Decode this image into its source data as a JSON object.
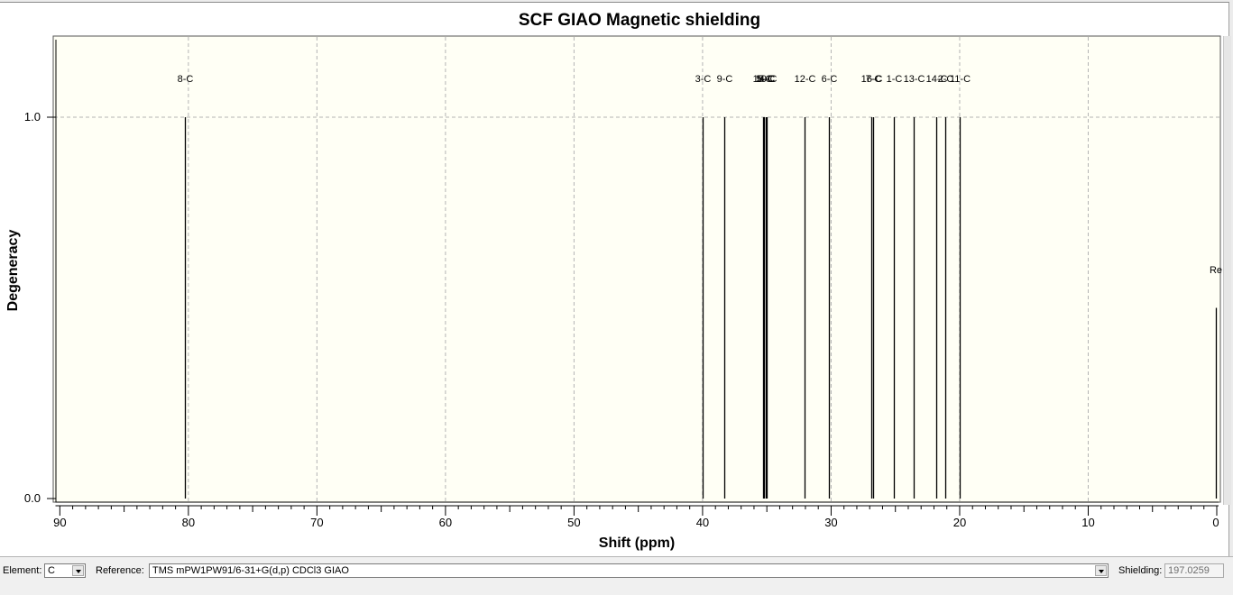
{
  "chart_data": {
    "type": "bar",
    "title": "SCF GIAO Magnetic shielding",
    "xlabel": "Shift (ppm)",
    "ylabel": "Degeneracy",
    "xlim": [
      90.2,
      0
    ],
    "ylim": [
      0,
      1.21
    ],
    "x_ticks": [
      90,
      80,
      70,
      60,
      50,
      40,
      30,
      20,
      10,
      0
    ],
    "x_tick_labels": [
      "90",
      "80",
      "70",
      "60",
      "50",
      "40",
      "30",
      "20",
      "10",
      "0"
    ],
    "y_ticks": [
      0,
      1
    ],
    "y_tick_labels": [
      "0.0",
      "1.0"
    ],
    "grid": true,
    "peaks": [
      {
        "label": "8-C",
        "x": 80.3,
        "y": 1.0
      },
      {
        "label": "3-C",
        "x": 40.0,
        "y": 1.0
      },
      {
        "label": "9-C",
        "x": 38.3,
        "y": 1.0
      },
      {
        "label": "15-C",
        "x": 35.3,
        "y": 1.0
      },
      {
        "label": "5-C",
        "x": 35.2,
        "y": 1.0
      },
      {
        "label": "10-C",
        "x": 35.1,
        "y": 1.0
      },
      {
        "label": "4-C",
        "x": 35.0,
        "y": 1.0
      },
      {
        "label": "12-C",
        "x": 32.1,
        "y": 1.0
      },
      {
        "label": "6-C",
        "x": 30.2,
        "y": 1.0
      },
      {
        "label": "16-C",
        "x": 26.9,
        "y": 1.0
      },
      {
        "label": "7-C",
        "x": 26.7,
        "y": 1.0
      },
      {
        "label": "1-C",
        "x": 25.1,
        "y": 1.0
      },
      {
        "label": "13-C",
        "x": 23.6,
        "y": 1.0
      },
      {
        "label": "14-C",
        "x": 21.8,
        "y": 1.0
      },
      {
        "label": "2-C",
        "x": 21.1,
        "y": 1.0
      },
      {
        "label": "11-C",
        "x": 20.0,
        "y": 1.0
      },
      {
        "label": "Re",
        "x": 0.1,
        "y": 0.5
      }
    ]
  },
  "controls": {
    "element_label": "Element:",
    "element_value": "C",
    "reference_label": "Reference:",
    "reference_value": "TMS mPW1PW91/6-31+G(d,p) CDCl3 GIAO",
    "shielding_label": "Shielding:",
    "shielding_value": "197.0259"
  },
  "colors": {
    "plot_background": "#fffff5",
    "grid": "#b4b4b4",
    "line": "#000000"
  }
}
